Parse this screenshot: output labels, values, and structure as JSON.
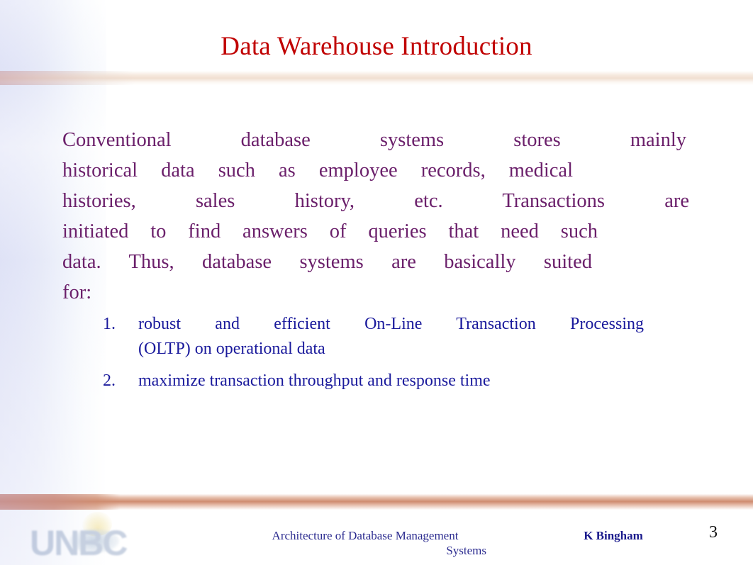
{
  "slide": {
    "title": "Data Warehouse Introduction",
    "page_number": "3",
    "colors": {
      "title_red": "#C00000",
      "body_purple": "#6B206B",
      "list_navy": "#1A1A9C",
      "footer_navy": "#2B2B8F",
      "band_bottom_salmon": "#CE8A6D",
      "band_top_cream": "#F0DDCE",
      "left_gradient_lavender": "#DFE2F6"
    }
  },
  "body": {
    "full_text": "Conventional database systems stores mainly historical data such as employee records, medical histories, sales history, etc. Transactions are initiated to find answers of queries that need such data. Thus, database systems are basically suited for:",
    "lines": [
      "Conventional database systems stores mainly",
      "historical data such as employee records, medical",
      "histories, sales history, etc. Transactions are",
      "initiated to find answers of queries that need such",
      "data. Thus, database systems are basically suited",
      "for:"
    ]
  },
  "list": {
    "items": [
      {
        "marker": "1.",
        "text": "robust and efficient On-Line Transaction Processing (OLTP) on operational data",
        "lines": [
          "robust and efficient    On-Line Transaction Processing",
          "(OLTP) on operational    data"
        ]
      },
      {
        "marker": "2.",
        "text": "maximize transaction throughput and response time",
        "lines": [
          "maximize transaction throughput and response time"
        ]
      }
    ]
  },
  "footer": {
    "course_line1": "Architecture of Database Management",
    "course_line2": "Systems",
    "course_full": "Architecture of Database Management Systems",
    "author": "K Bingham",
    "page_number": "3",
    "logo_text": "UNBC"
  }
}
